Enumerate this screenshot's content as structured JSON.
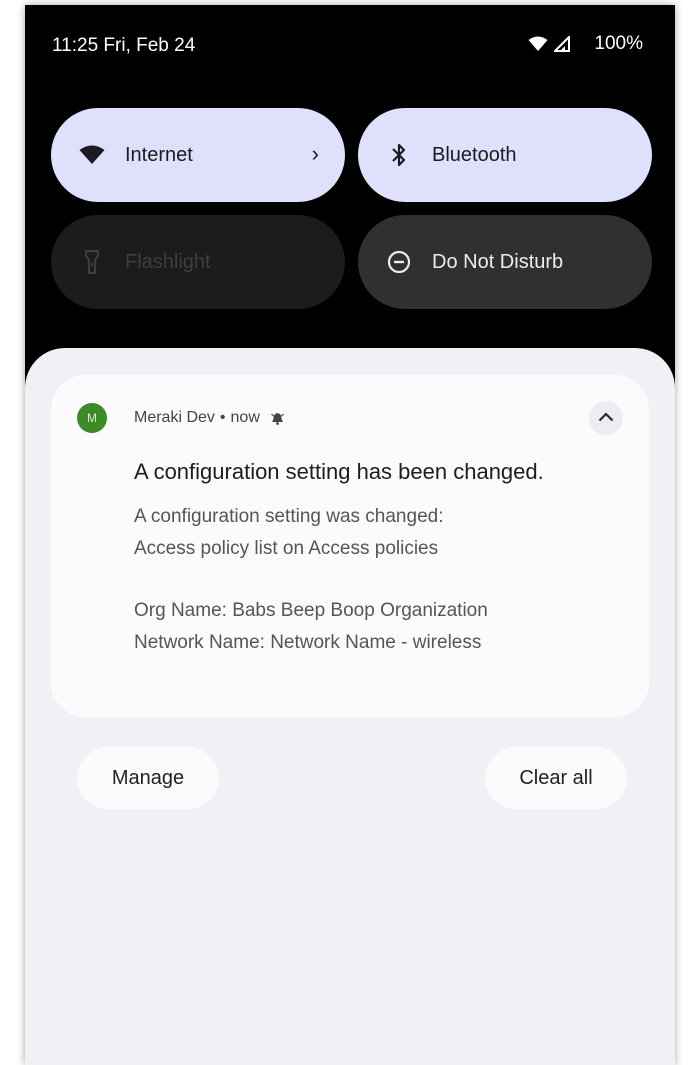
{
  "status_bar": {
    "time": "11:25 Fri, Feb 24",
    "battery": "100%",
    "icons": [
      "wifi-icon",
      "cell-signal-icon"
    ]
  },
  "quick_settings": {
    "tiles": [
      {
        "label": "Internet",
        "icon": "wifi-icon",
        "state": "on",
        "has_chevron": true,
        "chevron": "›"
      },
      {
        "label": "Bluetooth",
        "icon": "bluetooth-icon",
        "state": "on"
      },
      {
        "label": "Flashlight",
        "icon": "flashlight-icon",
        "state": "unavailable"
      },
      {
        "label": "Do Not Disturb",
        "icon": "do-not-disturb-icon",
        "state": "off"
      }
    ]
  },
  "notification": {
    "app_initial": "M",
    "app_name": "Meraki Dev",
    "separator": "•",
    "time": "now",
    "title": "A configuration setting has been changed.",
    "body_lines": [
      "A configuration setting was changed:",
      "Access policy list on Access policies"
    ],
    "details": [
      "Org Name: Babs Beep Boop Organization",
      "Network Name: Network Name - wireless"
    ],
    "accent_color": "#3c8a28"
  },
  "actions": {
    "manage": "Manage",
    "clear_all": "Clear all"
  },
  "colors": {
    "tile_active": "#dfe0fb",
    "shade_background": "#f1f0f5",
    "card_background": "#fbfbfd"
  }
}
